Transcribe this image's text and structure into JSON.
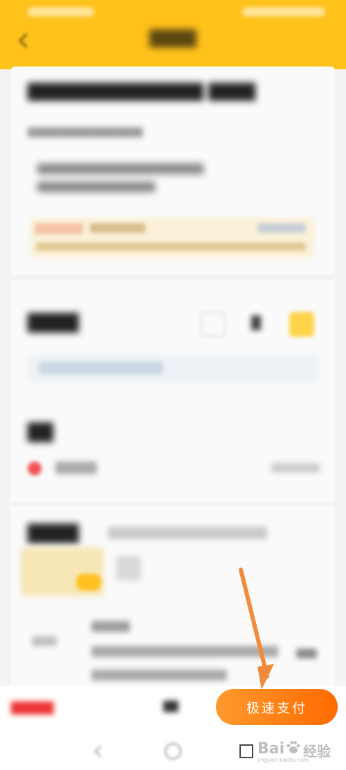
{
  "pay_button": {
    "label": "极速支付"
  },
  "watermark": {
    "text": "Bai",
    "text2": "经验",
    "subtext": "jingyan.baidu.com"
  },
  "annotation": {
    "color": "#f08a3c"
  },
  "colors": {
    "header": "#ffc21a",
    "pay_gradient_start": "#ff9a2e",
    "pay_gradient_end": "#ff6a00"
  }
}
